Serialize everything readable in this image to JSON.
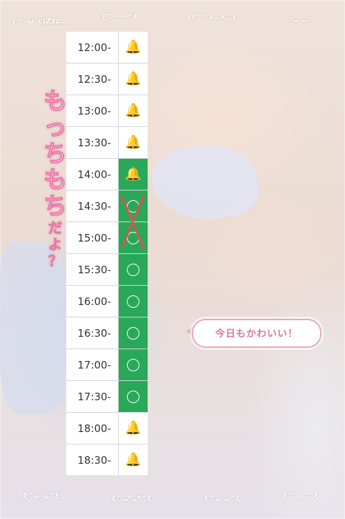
{
  "decor_top": [
    "(っ˘ω˘c)Zzz…",
    "ξ^ᴖ_ᴖ^ξ",
    "ε(^^×ᴗ×^ε",
    "^_ᴗ_ᴗ_^"
  ],
  "decor_bottom": [
    "ξ^ᴗ_ᴗ^ξ",
    "ξ^ᴗ*ᴗ*^ξ",
    "ξ^ᴗ_ᴗ^ξ",
    "ξ^ᴗ_ᴗ^ξ"
  ],
  "vertical_text": "もっちもち",
  "vertical_text_small": "だよ？",
  "speech_bubble": "今日もかわいい！",
  "schedule": [
    {
      "time": "12:00-",
      "status": "bell"
    },
    {
      "time": "12:30-",
      "status": "bell"
    },
    {
      "time": "13:00-",
      "status": "bell"
    },
    {
      "time": "13:30-",
      "status": "bell"
    },
    {
      "time": "14:00-",
      "status": "bell"
    },
    {
      "time": "14:30-",
      "status": "cancelled"
    },
    {
      "time": "15:00-",
      "status": "cancelled"
    },
    {
      "time": "15:30-",
      "status": "open"
    },
    {
      "time": "16:00-",
      "status": "open"
    },
    {
      "time": "16:30-",
      "status": "open"
    },
    {
      "time": "17:00-",
      "status": "open"
    },
    {
      "time": "17:30-",
      "status": "open"
    },
    {
      "time": "18:00-",
      "status": "bell"
    },
    {
      "time": "18:30-",
      "status": "bell"
    }
  ],
  "colors": {
    "green": "#2aa85a",
    "bell": "#f0b400",
    "cross": "#d9534f",
    "bubble_text": "#d97994"
  }
}
